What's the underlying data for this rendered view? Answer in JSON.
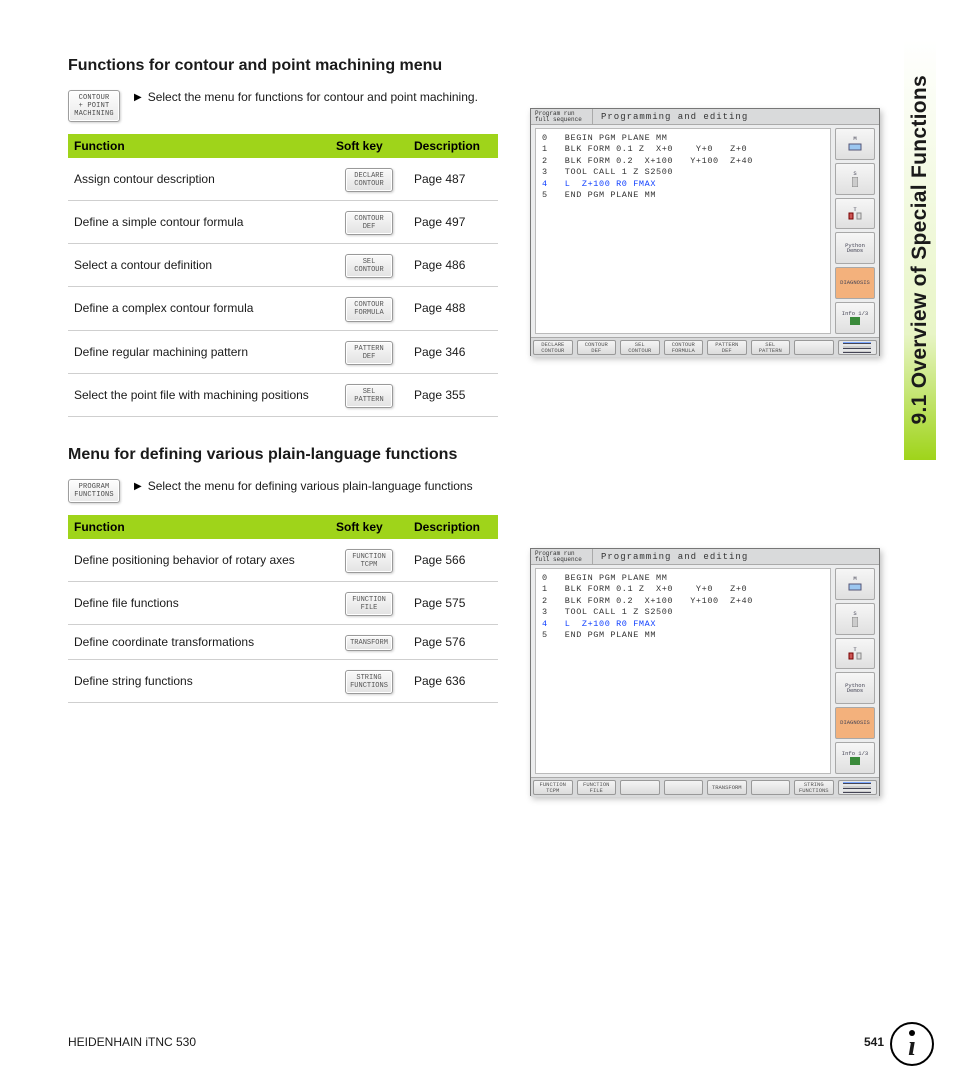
{
  "side_tab": "9.1 Overview of Special Functions",
  "section1": {
    "title": "Functions for contour and point machining menu",
    "menu_button": "CONTOUR\n+ POINT\nMACHINING",
    "intro": "Select the menu for functions for contour and point machining.",
    "headers": {
      "fn": "Function",
      "sk": "Soft key",
      "dc": "Description"
    },
    "rows": [
      {
        "fn": "Assign contour description",
        "sk": "DECLARE\nCONTOUR",
        "dc": "Page 487"
      },
      {
        "fn": "Define a simple contour formula",
        "sk": "CONTOUR\nDEF",
        "dc": "Page 497"
      },
      {
        "fn": "Select a contour definition",
        "sk": "SEL\nCONTOUR",
        "dc": "Page 486"
      },
      {
        "fn": "Define a complex contour formula",
        "sk": "CONTOUR\nFORMULA",
        "dc": "Page 488"
      },
      {
        "fn": "Define regular machining pattern",
        "sk": "PATTERN\nDEF",
        "dc": "Page 346"
      },
      {
        "fn": "Select the point file with machining positions",
        "sk": "SEL\nPATTERN",
        "dc": "Page 355"
      }
    ]
  },
  "section2": {
    "title": "Menu for defining various plain-language functions",
    "menu_button": "PROGRAM\nFUNCTIONS",
    "intro": "Select the menu for defining various plain-language functions",
    "headers": {
      "fn": "Function",
      "sk": "Soft key",
      "dc": "Description"
    },
    "rows": [
      {
        "fn": "Define positioning behavior of rotary axes",
        "sk": "FUNCTION\nTCPM",
        "dc": "Page 566"
      },
      {
        "fn": "Define file functions",
        "sk": "FUNCTION\nFILE",
        "dc": "Page 575"
      },
      {
        "fn": "Define coordinate transformations",
        "sk": "TRANSFORM",
        "dc": "Page 576"
      },
      {
        "fn": "Define string functions",
        "sk": "STRING\nFUNCTIONS",
        "dc": "Page 636"
      }
    ]
  },
  "cnc": {
    "mode": "Program run\nfull sequence",
    "title": "Programming and editing",
    "code_plain": "0   BEGIN PGM PLANE MM\n1   BLK FORM 0.1 Z  X+0    Y+0   Z+0\n2   BLK FORM 0.2  X+100   Y+100  Z+40\n3   TOOL CALL 1 Z S2500",
    "code_hl": "4   L  Z+100 R0 FMAX",
    "code_tail": "5   END PGM PLANE MM",
    "side": [
      "M",
      "S",
      "T",
      "Python\nDemos",
      "DIAGNOSIS",
      "Info 1/3"
    ],
    "soft1": [
      "DECLARE\nCONTOUR",
      "CONTOUR\nDEF",
      "SEL\nCONTOUR",
      "CONTOUR\nFORMULA",
      "PATTERN\nDEF",
      "SEL\nPATTERN",
      "",
      ""
    ],
    "soft2": [
      "FUNCTION\nTCPM",
      "FUNCTION\nFILE",
      "",
      "",
      "TRANSFORM",
      "",
      "STRING\nFUNCTIONS",
      ""
    ]
  },
  "footer": {
    "left": "HEIDENHAIN iTNC 530",
    "page": "541"
  }
}
